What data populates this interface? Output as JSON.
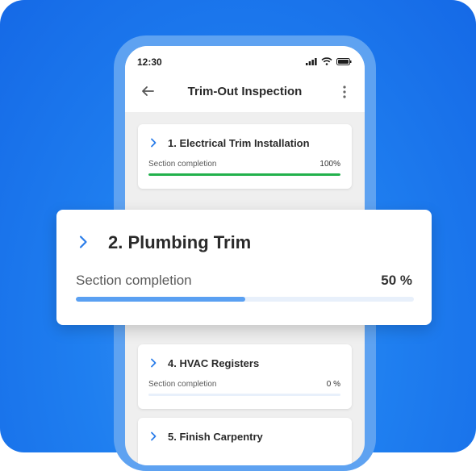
{
  "status_bar": {
    "time": "12:30"
  },
  "header": {
    "title": "Trim-Out Inspection"
  },
  "sections": [
    {
      "title": "1. Electrical Trim Installation",
      "label": "Section completion",
      "value_text": "100%",
      "progress": 1.0,
      "color": "#22b14c"
    },
    {
      "title": "2. Plumbing Trim",
      "label": "Section completion",
      "value_text": "50 %",
      "progress": 0.5,
      "color": "#5aa0f2"
    },
    {
      "title": "4. HVAC Registers",
      "label": "Section completion",
      "value_text": "0 %",
      "progress": 0.0,
      "color": "#5aa0f2"
    },
    {
      "title": "5. Finish Carpentry"
    }
  ],
  "colors": {
    "accent": "#1f7ff0",
    "chevron": "#2b7de9"
  },
  "icons": [
    "signal-icon",
    "wifi-icon",
    "battery-icon",
    "back-arrow-icon",
    "more-vertical-icon",
    "chevron-right-icon"
  ]
}
